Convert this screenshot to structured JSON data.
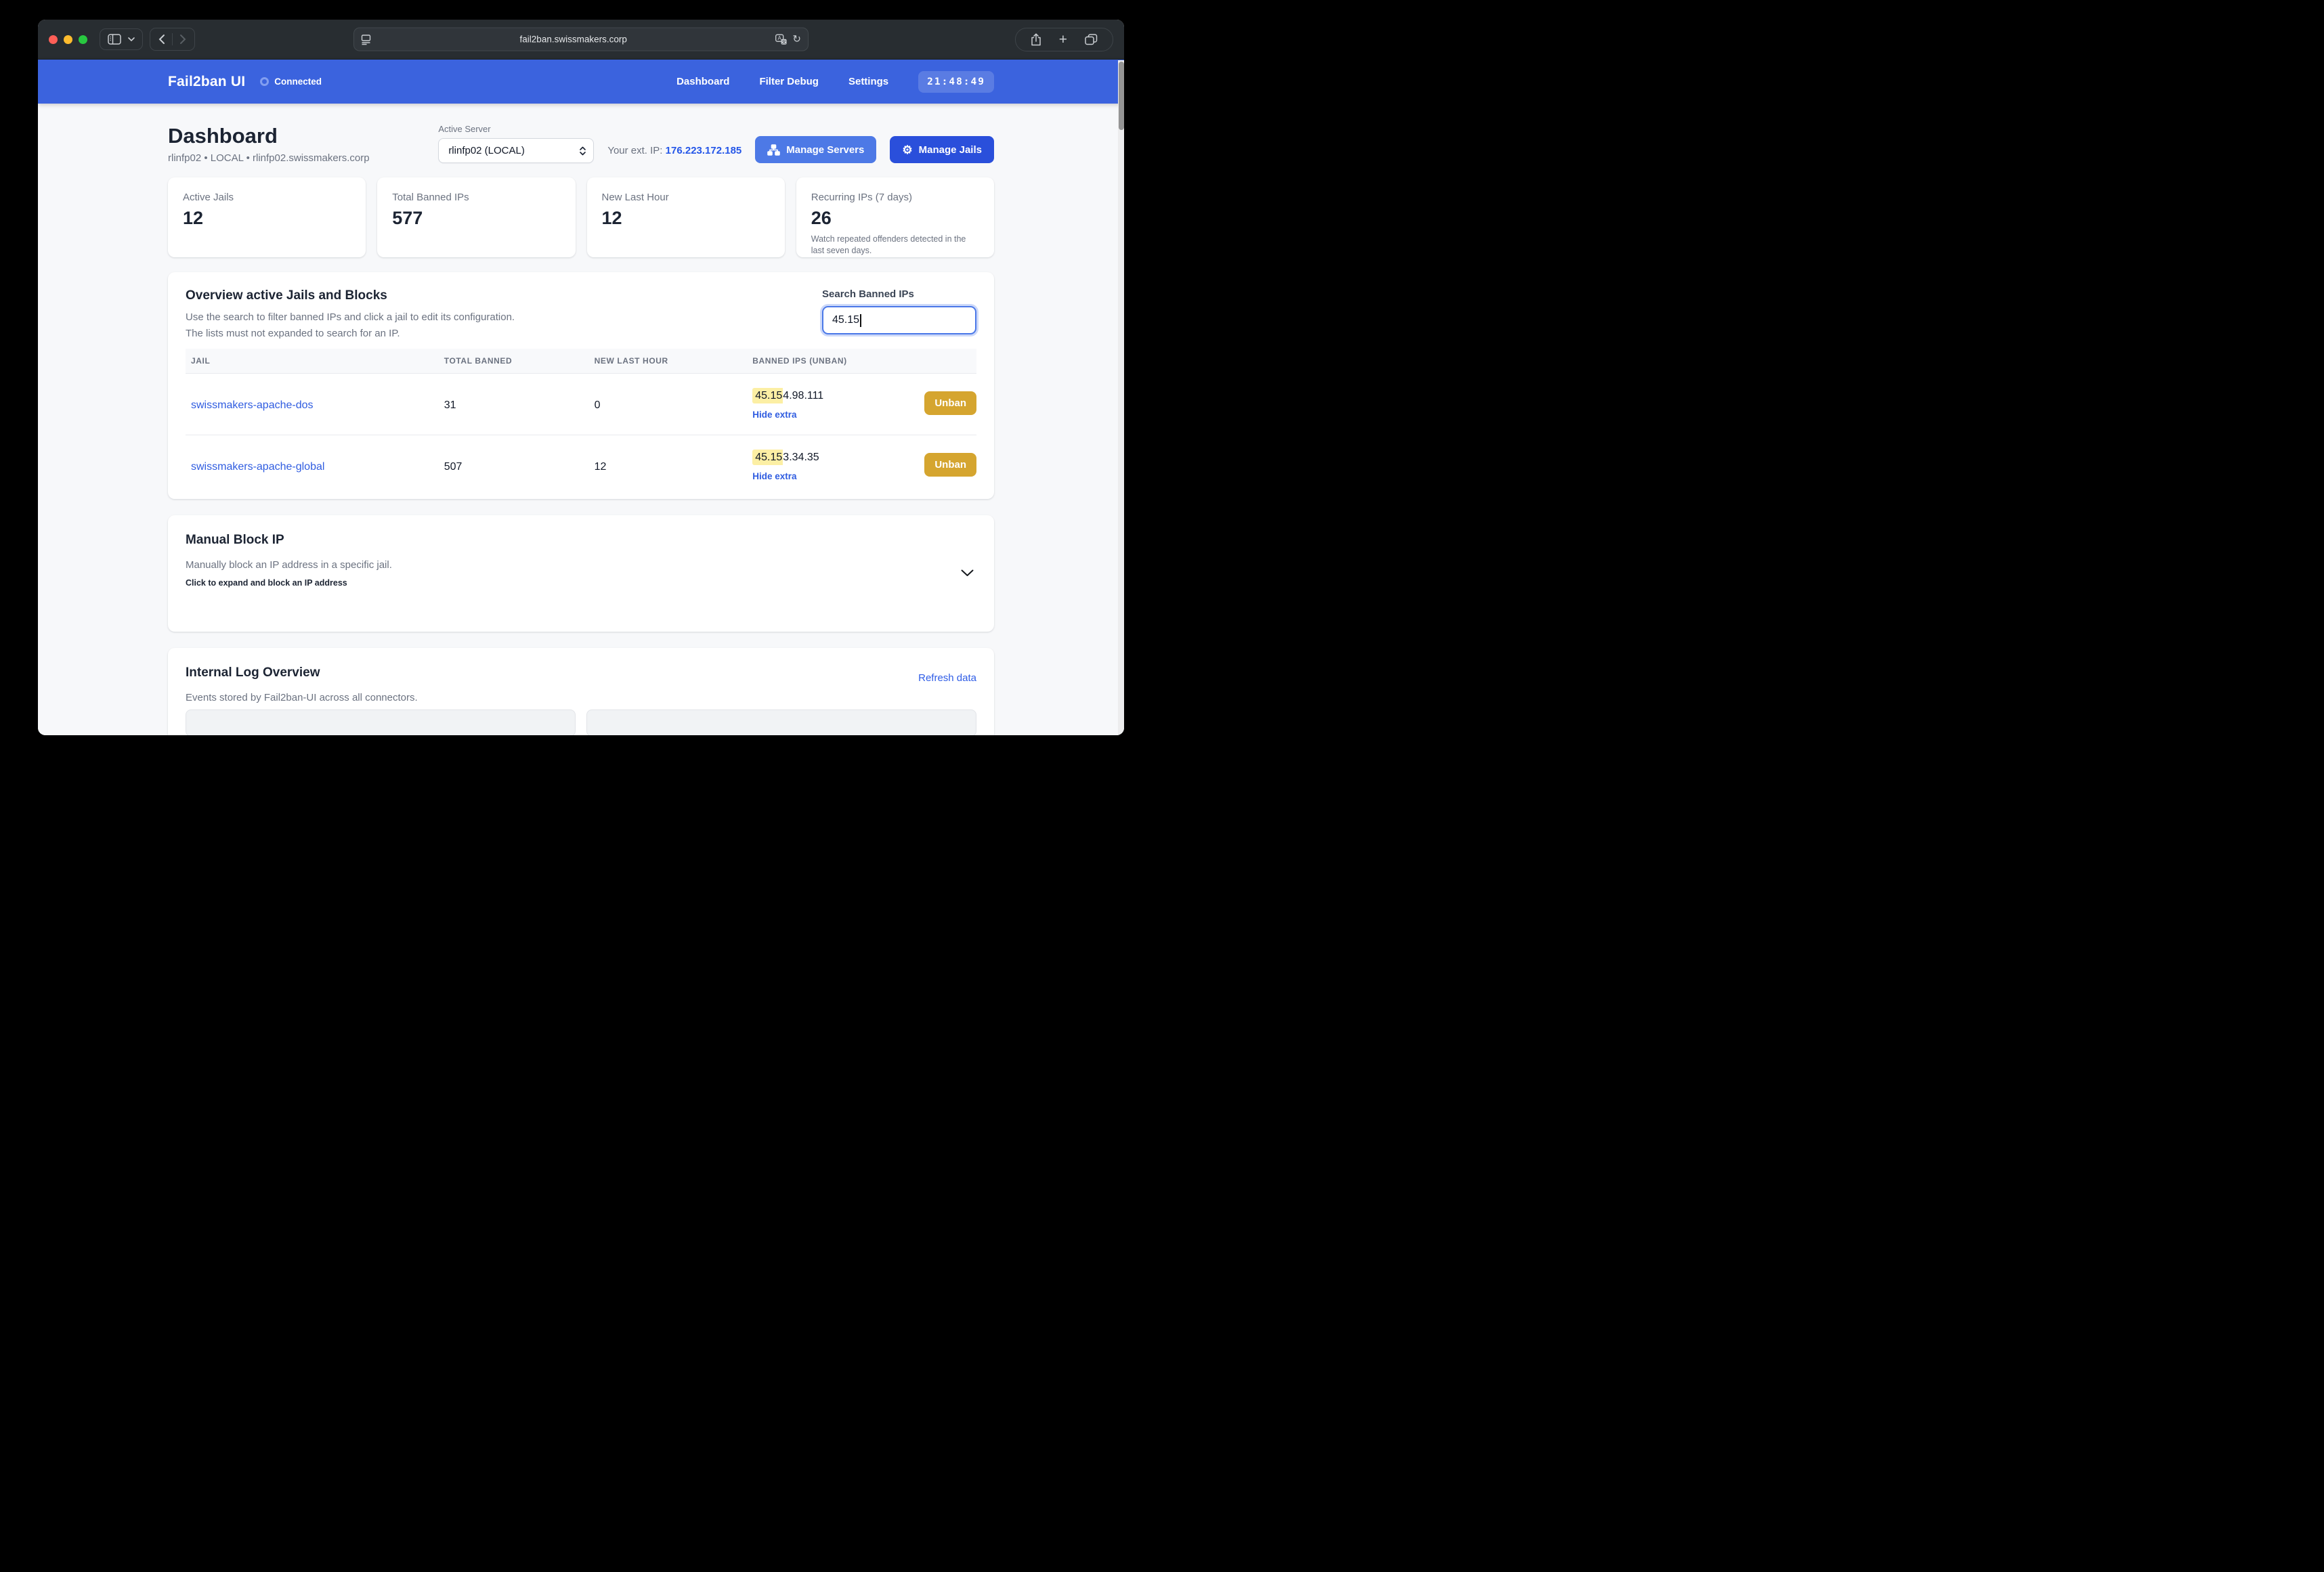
{
  "browser": {
    "url": "fail2ban.swissmakers.corp"
  },
  "header": {
    "brand": "Fail2ban UI",
    "status": "Connected",
    "nav": [
      {
        "label": "Dashboard"
      },
      {
        "label": "Filter Debug"
      },
      {
        "label": "Settings"
      }
    ],
    "clock": "21:48:49"
  },
  "page": {
    "title": "Dashboard",
    "subtitle": "rlinfp02 • LOCAL • rlinfp02.swissmakers.corp",
    "active_server_label": "Active Server",
    "active_server_value": "rlinfp02 (LOCAL)",
    "ext_ip_label": "Your ext. IP:",
    "ext_ip": "176.223.172.185",
    "manage_servers_label": "Manage Servers",
    "manage_jails_label": "Manage Jails"
  },
  "stats": [
    {
      "label": "Active Jails",
      "value": "12"
    },
    {
      "label": "Total Banned IPs",
      "value": "577"
    },
    {
      "label": "New Last Hour",
      "value": "12"
    },
    {
      "label": "Recurring IPs (7 days)",
      "value": "26",
      "description": "Watch repeated offenders detected in the last seven days."
    }
  ],
  "overview": {
    "title": "Overview active Jails and Blocks",
    "description1": "Use the search to filter banned IPs and click a jail to edit its configuration.",
    "description2": "The lists must not expanded to search for an IP.",
    "search_label": "Search Banned IPs",
    "search_value": "45.15",
    "table": {
      "headers": [
        "JAIL",
        "TOTAL BANNED",
        "NEW LAST HOUR",
        "BANNED IPS (UNBAN)"
      ],
      "rows": [
        {
          "jail": "swissmakers-apache-dos",
          "total_banned": "31",
          "new_last_hour": "0",
          "ip_highlight": "45.15",
          "ip_rest": "4.98.111",
          "hide_extra": "Hide extra",
          "unban": "Unban"
        },
        {
          "jail": "swissmakers-apache-global",
          "total_banned": "507",
          "new_last_hour": "12",
          "ip_highlight": "45.15",
          "ip_rest": "3.34.35",
          "hide_extra": "Hide extra",
          "unban": "Unban"
        }
      ]
    }
  },
  "manual_block": {
    "title": "Manual Block IP",
    "description": "Manually block an IP address in a specific jail.",
    "hint": "Click to expand and block an IP address"
  },
  "log_overview": {
    "title": "Internal Log Overview",
    "description": "Events stored by Fail2ban-UI across all connectors.",
    "refresh_label": "Refresh data"
  },
  "colors": {
    "header_bg": "#3b63de",
    "primary_button": "#2a4fdb",
    "secondary_button": "#4d79e6",
    "unban_button": "#d5a52f",
    "search_highlight": "#fcefa4",
    "link": "#2f5ce0",
    "ext_ip": "#2456e8",
    "traffic_red": "#ff5f57",
    "traffic_yellow": "#febc2e",
    "traffic_green": "#28c840"
  }
}
